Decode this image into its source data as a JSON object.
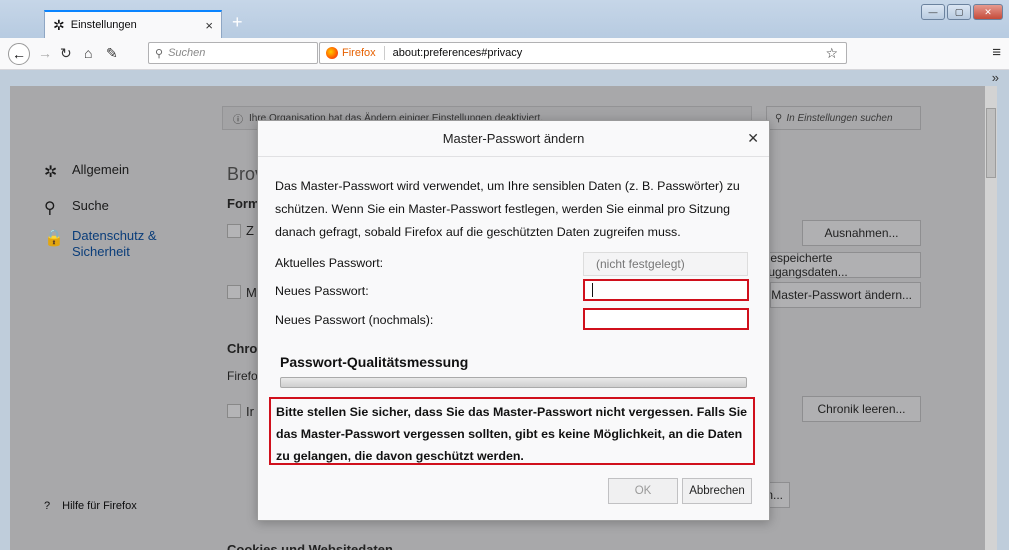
{
  "window": {
    "tab_label": "Einstellungen",
    "tab_close": "×",
    "new_tab": "+",
    "win_min": "—",
    "win_max": "▢",
    "win_close": "✕"
  },
  "navbar": {
    "search_placeholder": "Suchen",
    "site_identity": "Firefox",
    "url": "about:preferences#privacy"
  },
  "page": {
    "banner": "Ihre Organisation hat das Ändern einiger Einstellungen deaktiviert.",
    "find_placeholder": "In Einstellungen suchen",
    "sidebar": [
      {
        "label": "Allgemein"
      },
      {
        "label": "Suche"
      },
      {
        "label": "Datenschutz & Sicherheit"
      }
    ],
    "help": "Hilfe für Firefox",
    "bg_heading_1": "Brov",
    "bg_heading_2": "Form",
    "bg_chk_1": "Z",
    "bg_chk_2": "M",
    "bg_heading_3": "Chro",
    "bg_line": "Firefo",
    "bg_chk_3": "Ir",
    "bg_heading_4": "Cookies und Websitedaten",
    "btn_exceptions": "Ausnahmen...",
    "btn_saved_logins": "Gespeicherte Zugangsdaten...",
    "btn_master_pw": "Master-Passwort ändern...",
    "btn_clear_history": "Chronik leeren...",
    "btn_partial": "n..."
  },
  "dialog": {
    "title": "Master-Passwort ändern",
    "description": "Das Master-Passwort wird verwendet, um Ihre sensiblen Daten (z. B. Passwörter) zu schützen. Wenn Sie ein Master-Passwort festlegen, werden Sie einmal pro Sitzung danach gefragt, sobald Firefox auf die geschützten Daten zugreifen muss.",
    "current_label": "Aktuelles Passwort:",
    "current_value": "(nicht festgelegt)",
    "new_label": "Neues Passwort:",
    "confirm_label": "Neues Passwort (nochmals):",
    "quality_title": "Passwort-Qualitätsmessung",
    "quality_value": 0,
    "warning": "Bitte stellen Sie sicher, dass Sie das Master-Passwort nicht vergessen. Falls Sie das Master-Passwort vergessen sollten, gibt es keine Möglichkeit, an die Daten zu gelangen, die davon geschützt werden.",
    "ok_label": "OK",
    "cancel_label": "Abbrechen"
  },
  "colors": {
    "highlight": "#d0101c",
    "accent": "#0a84ff"
  }
}
